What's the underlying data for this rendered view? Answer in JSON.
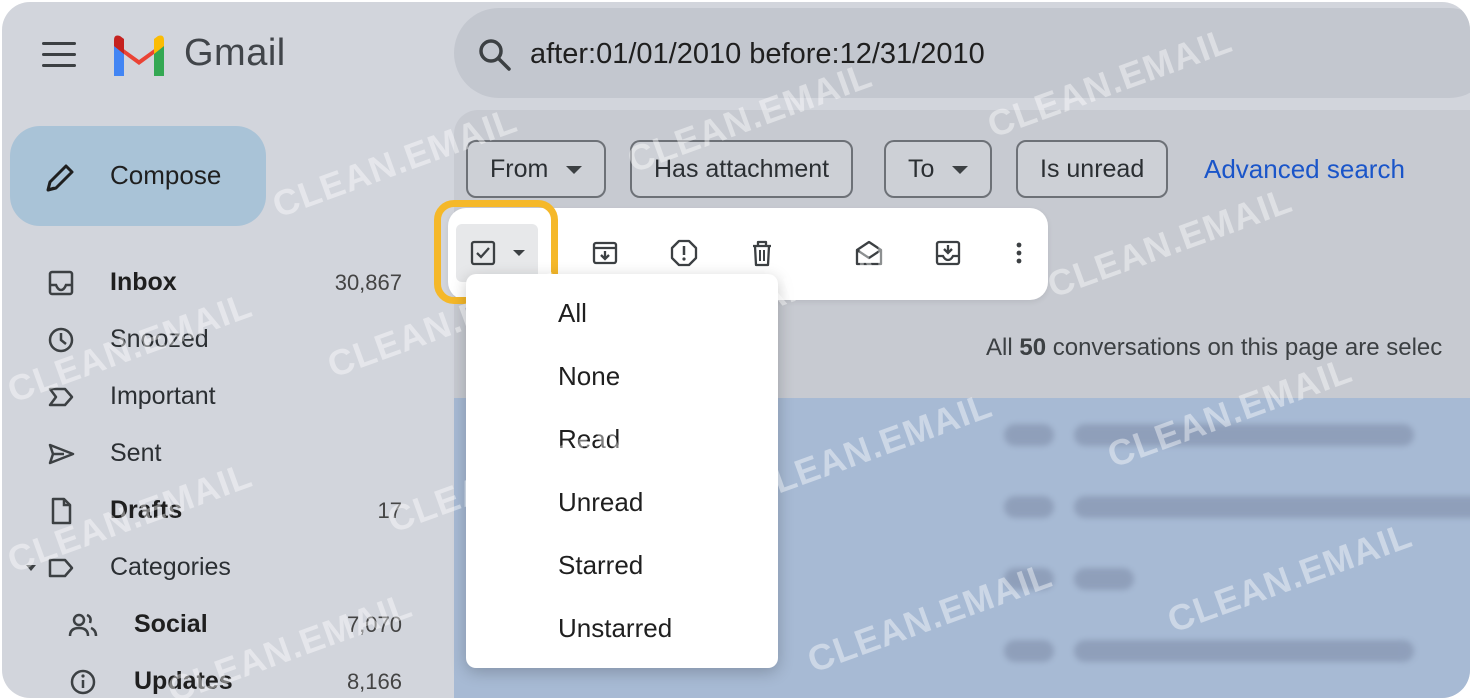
{
  "header": {
    "brand": "Gmail",
    "search_query": "after:01/01/2010 before:12/31/2010"
  },
  "sidebar": {
    "compose_label": "Compose",
    "items": [
      {
        "label": "Inbox",
        "count": "30,867"
      },
      {
        "label": "Snoozed",
        "count": ""
      },
      {
        "label": "Important",
        "count": ""
      },
      {
        "label": "Sent",
        "count": ""
      },
      {
        "label": "Drafts",
        "count": "17"
      },
      {
        "label": "Categories",
        "count": ""
      },
      {
        "label": "Social",
        "count": "7,070"
      },
      {
        "label": "Updates",
        "count": "8,166"
      }
    ]
  },
  "filters": {
    "chips": [
      "From",
      "Has attachment",
      "To",
      "Is unread"
    ],
    "advanced_search": "Advanced search"
  },
  "toolbar": {
    "icons": [
      "select-checkbox-icon",
      "archive-icon",
      "report-spam-icon",
      "delete-icon",
      "mark-read-icon",
      "move-to-inbox-icon",
      "more-icon"
    ]
  },
  "selection_info": {
    "prefix": "All ",
    "count": "50",
    "suffix": " conversations on this page are selec"
  },
  "select_menu": {
    "options": [
      "All",
      "None",
      "Read",
      "Unread",
      "Starred",
      "Unstarred"
    ]
  },
  "watermark": "CLEAN.EMAIL",
  "colors": {
    "highlight": "#f5b829",
    "link": "#1a55c9",
    "compose_bg": "#a9c3d7",
    "selected_rows": "#a7bad4"
  }
}
